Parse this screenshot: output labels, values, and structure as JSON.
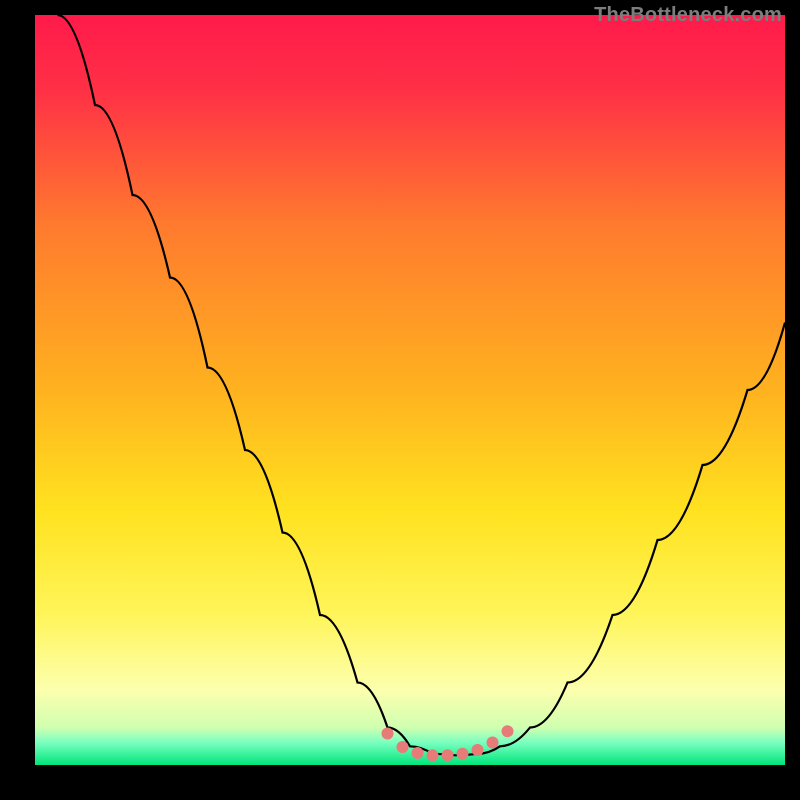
{
  "watermark": "TheBottleneck.com",
  "colors": {
    "gradient_top": "#ff1a4a",
    "gradient_mid1": "#ff7a2e",
    "gradient_mid2": "#ffd21f",
    "gradient_mid3": "#fff250",
    "gradient_bottom_y": "#fcffae",
    "gradient_bottom_g": "#00e57a",
    "curve": "#000000",
    "dots": "#e77b78",
    "frame": "#000000"
  },
  "chart_data": {
    "type": "line",
    "title": "",
    "xlabel": "",
    "ylabel": "",
    "xlim": [
      0,
      100
    ],
    "ylim": [
      0,
      100
    ],
    "series": [
      {
        "name": "bottleneck-curve",
        "x": [
          3,
          8,
          13,
          18,
          23,
          28,
          33,
          38,
          43,
          47,
          50,
          53,
          56,
          59,
          62,
          66,
          71,
          77,
          83,
          89,
          95,
          100
        ],
        "y": [
          100,
          88,
          76,
          65,
          53,
          42,
          31,
          20,
          11,
          5,
          2.5,
          1.5,
          1.3,
          1.5,
          2.5,
          5,
          11,
          20,
          30,
          40,
          50,
          59
        ]
      }
    ],
    "markers": {
      "name": "trough-dots",
      "x": [
        47,
        49,
        51,
        53,
        55,
        57,
        59,
        61,
        63
      ],
      "y": [
        4.2,
        2.4,
        1.6,
        1.3,
        1.3,
        1.5,
        2.0,
        3.0,
        4.5
      ]
    }
  }
}
